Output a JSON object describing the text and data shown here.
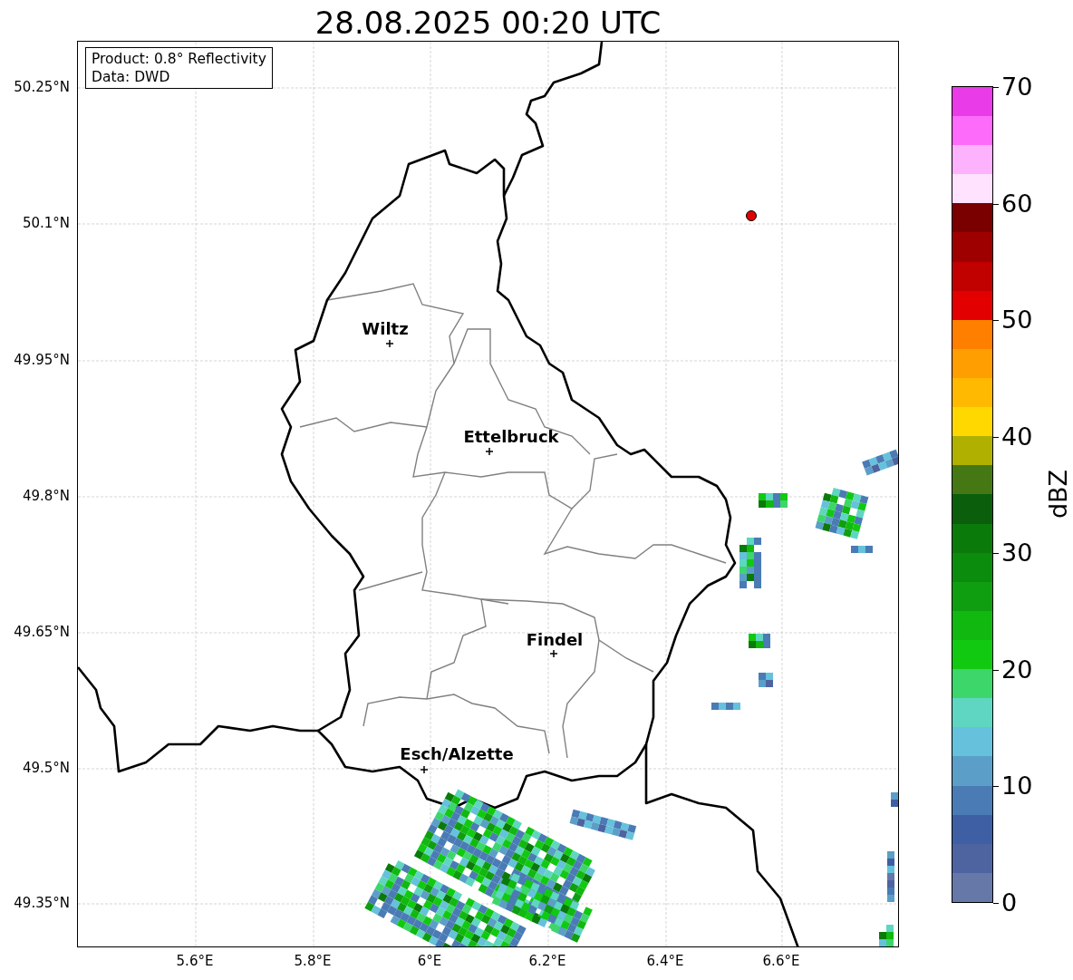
{
  "title": "28.08.2025 00:20 UTC",
  "info_box": {
    "lines": [
      "Product: 0.8° Reflectivity",
      "Data: DWD"
    ]
  },
  "map": {
    "xticks": [
      "5.6°E",
      "5.8°E",
      "6°E",
      "6.2°E",
      "6.4°E",
      "6.6°E"
    ],
    "yticks": [
      "50.25°N",
      "50.1°N",
      "49.95°N",
      "49.8°N",
      "49.65°N",
      "49.5°N",
      "49.35°N"
    ],
    "cities": [
      {
        "name": "Wiltz"
      },
      {
        "name": "Ettelbruck"
      },
      {
        "name": "Findel"
      },
      {
        "name": "Esch/Alzette"
      }
    ]
  },
  "colorbar": {
    "label": "dBZ",
    "ticks": [
      "70",
      "60",
      "50",
      "40",
      "30",
      "20",
      "10",
      "0"
    ],
    "bins": [
      {
        "color": "#6678a8"
      },
      {
        "color": "#4e64a0"
      },
      {
        "color": "#3f5fa4"
      },
      {
        "color": "#4a7bb5"
      },
      {
        "color": "#5b9fc8"
      },
      {
        "color": "#65c1dc"
      },
      {
        "color": "#5fd6c2"
      },
      {
        "color": "#3dd66b"
      },
      {
        "color": "#11c911"
      },
      {
        "color": "#10b810"
      },
      {
        "color": "#0f9e0f"
      },
      {
        "color": "#0c8c0c"
      },
      {
        "color": "#0a7a0a"
      },
      {
        "color": "#0b5e0b"
      },
      {
        "color": "#457814"
      },
      {
        "color": "#b0b000"
      },
      {
        "color": "#ffd800"
      },
      {
        "color": "#ffb900"
      },
      {
        "color": "#ff9e00"
      },
      {
        "color": "#ff7f00"
      },
      {
        "color": "#e20000"
      },
      {
        "color": "#c10000"
      },
      {
        "color": "#9e0000"
      },
      {
        "color": "#7a0000"
      },
      {
        "color": "#fee2fe"
      },
      {
        "color": "#fdb2fd"
      },
      {
        "color": "#fd6bfb"
      },
      {
        "color": "#e93be8"
      }
    ]
  }
}
